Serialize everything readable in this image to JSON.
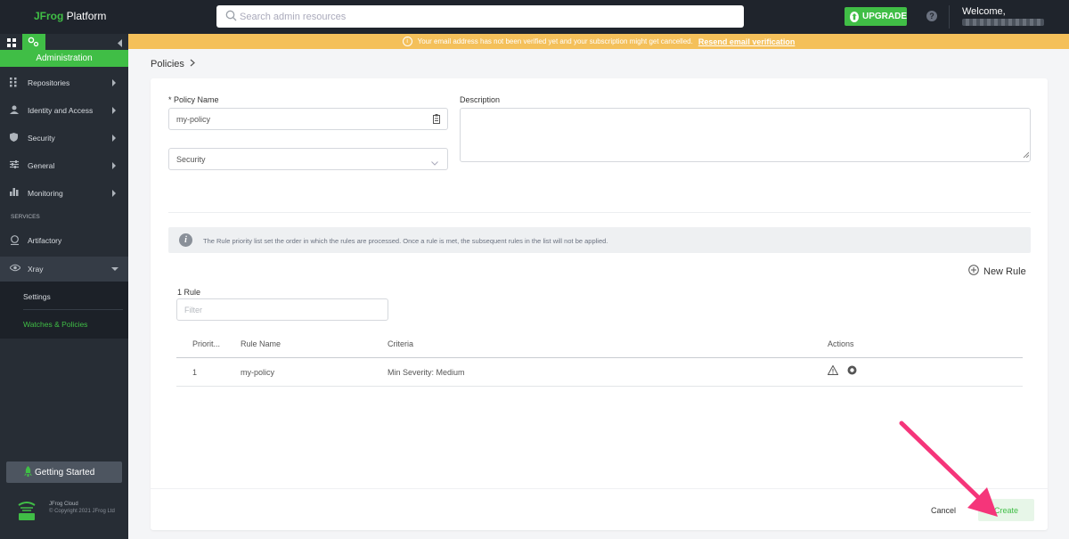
{
  "topbar": {
    "logo_brand": "JFrog",
    "logo_rest": " Platform",
    "search_placeholder": "Search admin resources",
    "upgrade_label": "UPGRADE",
    "help_label": "?",
    "welcome": "Welcome,"
  },
  "sidebar": {
    "section_title": "Administration",
    "items": [
      {
        "label": "Repositories",
        "icon": "repositories-icon"
      },
      {
        "label": "Identity and Access",
        "icon": "user-icon"
      },
      {
        "label": "Security",
        "icon": "shield-icon"
      },
      {
        "label": "General",
        "icon": "sliders-icon"
      },
      {
        "label": "Monitoring",
        "icon": "bar-chart-icon"
      }
    ],
    "services_label": "SERVICES",
    "artifactory_label": "Artifactory",
    "xray_label": "Xray",
    "xray_sub": [
      {
        "label": "Settings"
      },
      {
        "label": "Watches & Policies"
      }
    ],
    "getting_started": "Getting Started",
    "footer_line1": "JFrog Cloud",
    "footer_line2": "© Copyright 2021 JFrog Ltd"
  },
  "banner": {
    "message": "Your email address has not been verified yet and your subscription might get cancelled.",
    "link": "Resend email verification"
  },
  "breadcrumb": {
    "label": "Policies"
  },
  "form": {
    "policy_name_label": "* Policy Name",
    "policy_name_value": "my-policy",
    "type_value": "Security",
    "description_label": "Description",
    "description_value": ""
  },
  "info": {
    "text": "The Rule priority list set the order in which the rules are processed. Once a rule is met, the subsequent rules in the list will not be applied."
  },
  "rules": {
    "new_rule_label": "New Rule",
    "count_label": "1 Rule",
    "filter_placeholder": "Filter",
    "columns": [
      "Priorit...",
      "Rule Name",
      "Criteria",
      "Actions"
    ],
    "rows": [
      {
        "priority": "1",
        "name": "my-policy",
        "criteria": "Min Severity: Medium"
      }
    ]
  },
  "footer": {
    "cancel_label": "Cancel",
    "create_label": "Create"
  },
  "colors": {
    "brand_green": "#40be46",
    "banner_yellow": "#f4c05a",
    "sidebar_bg": "#272d35",
    "topbar_bg": "#1f242c",
    "annotation_arrow": "#f5357a"
  }
}
